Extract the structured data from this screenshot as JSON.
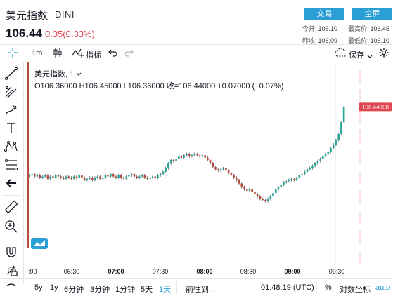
{
  "header": {
    "name": "美元指数",
    "code": "DINI",
    "price": "106.44",
    "change": "0.35(0.33%)",
    "trade_button": "交易",
    "fullscreen_button": "全屏",
    "stats": [
      {
        "label": "今开:",
        "value": "106.10"
      },
      {
        "label": "最高价:",
        "value": "106.45"
      },
      {
        "label": "昨收:",
        "value": "106.09"
      },
      {
        "label": "最低价:",
        "value": "106.10"
      }
    ]
  },
  "toolbar": {
    "interval": "1m",
    "indicators": "指标",
    "save": "保存"
  },
  "legend": {
    "title": "美元指数, 1",
    "ohlc": "O106.36000  H106.45000  L106.36000  收=106.44000  +0.07000 (+0.07%)"
  },
  "chart_data": {
    "type": "candlestick",
    "symbol": "DINI",
    "interval": "1m",
    "x_tick_labels": [
      ":00",
      "06:30",
      "07:00",
      "07:30",
      "08:00",
      "08:30",
      "09:00",
      "09:30"
    ],
    "last_price_label": "106.44000",
    "last_price": 106.44,
    "close_path": [
      0.4,
      0.41,
      0.39,
      0.4,
      0.38,
      0.39,
      0.4,
      0.37,
      0.39,
      0.38,
      0.4,
      0.39,
      0.38,
      0.37,
      0.39,
      0.38,
      0.37,
      0.39,
      0.38,
      0.4,
      0.38,
      0.36,
      0.37,
      0.38,
      0.36,
      0.38,
      0.39,
      0.37,
      0.38,
      0.4,
      0.39,
      0.41,
      0.39,
      0.38,
      0.4,
      0.38,
      0.37,
      0.39,
      0.4,
      0.41,
      0.39,
      0.38,
      0.39,
      0.4,
      0.38,
      0.37,
      0.38,
      0.39,
      0.38,
      0.4,
      0.41,
      0.43,
      0.46,
      0.5,
      0.53,
      0.52,
      0.54,
      0.56,
      0.55,
      0.57,
      0.58,
      0.56,
      0.57,
      0.58,
      0.57,
      0.56,
      0.57,
      0.55,
      0.53,
      0.5,
      0.47,
      0.45,
      0.44,
      0.45,
      0.46,
      0.44,
      0.42,
      0.4,
      0.38,
      0.36,
      0.33,
      0.3,
      0.28,
      0.27,
      0.28,
      0.26,
      0.24,
      0.22,
      0.2,
      0.19,
      0.18,
      0.2,
      0.22,
      0.25,
      0.28,
      0.3,
      0.32,
      0.34,
      0.35,
      0.36,
      0.37,
      0.36,
      0.38,
      0.4,
      0.41,
      0.43,
      0.45,
      0.46,
      0.48,
      0.5,
      0.52,
      0.54,
      0.56,
      0.58,
      0.6,
      0.63,
      0.66,
      0.7,
      0.75,
      0.85,
      0.98
    ]
  },
  "bottom": {
    "ranges": [
      "5y",
      "1y",
      "6分钟",
      "3分钟",
      "1分钟",
      "5天",
      "1天"
    ],
    "active_range": "1天",
    "goto": "前往到...",
    "time": "01:48:19 (UTC)",
    "percent": "%",
    "log_scale": "对数坐标",
    "auto": "auto"
  },
  "colors": {
    "up": "#26a69a",
    "down": "#b94b3b",
    "accent": "#2a9fd6",
    "price_line": "#e0464f",
    "change": "#e0464f"
  }
}
